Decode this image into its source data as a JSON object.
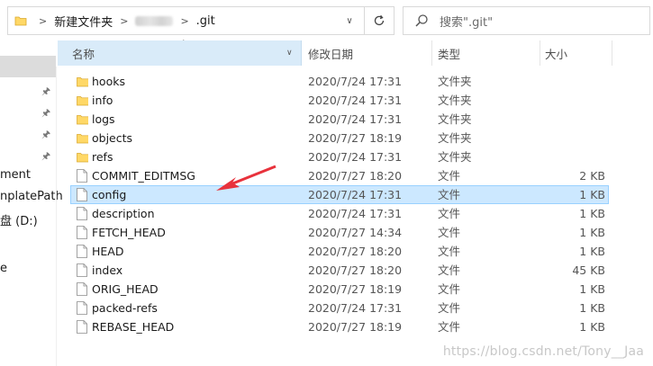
{
  "address": {
    "segment1": "新建文件夹",
    "segment3": ".git",
    "separator": ">"
  },
  "search": {
    "placeholder": "搜索\".git\""
  },
  "columns": {
    "name": "名称",
    "date": "修改日期",
    "type": "类型",
    "size": "大小"
  },
  "nav": {
    "items": [
      "ment",
      "nplatePath",
      "盘 (D:)",
      "e"
    ]
  },
  "files": [
    {
      "name": "hooks",
      "date": "2020/7/24 17:31",
      "type": "文件夹",
      "size": "",
      "kind": "folder"
    },
    {
      "name": "info",
      "date": "2020/7/24 17:31",
      "type": "文件夹",
      "size": "",
      "kind": "folder"
    },
    {
      "name": "logs",
      "date": "2020/7/24 17:31",
      "type": "文件夹",
      "size": "",
      "kind": "folder"
    },
    {
      "name": "objects",
      "date": "2020/7/27 18:19",
      "type": "文件夹",
      "size": "",
      "kind": "folder"
    },
    {
      "name": "refs",
      "date": "2020/7/24 17:31",
      "type": "文件夹",
      "size": "",
      "kind": "folder"
    },
    {
      "name": "COMMIT_EDITMSG",
      "date": "2020/7/27 18:20",
      "type": "文件",
      "size": "2 KB",
      "kind": "file"
    },
    {
      "name": "config",
      "date": "2020/7/24 17:31",
      "type": "文件",
      "size": "1 KB",
      "kind": "file",
      "selected": true
    },
    {
      "name": "description",
      "date": "2020/7/24 17:31",
      "type": "文件",
      "size": "1 KB",
      "kind": "file"
    },
    {
      "name": "FETCH_HEAD",
      "date": "2020/7/27 14:34",
      "type": "文件",
      "size": "1 KB",
      "kind": "file"
    },
    {
      "name": "HEAD",
      "date": "2020/7/27 18:20",
      "type": "文件",
      "size": "1 KB",
      "kind": "file"
    },
    {
      "name": "index",
      "date": "2020/7/27 18:20",
      "type": "文件",
      "size": "45 KB",
      "kind": "file"
    },
    {
      "name": "ORIG_HEAD",
      "date": "2020/7/27 18:19",
      "type": "文件",
      "size": "1 KB",
      "kind": "file"
    },
    {
      "name": "packed-refs",
      "date": "2020/7/24 17:31",
      "type": "文件",
      "size": "1 KB",
      "kind": "file"
    },
    {
      "name": "REBASE_HEAD",
      "date": "2020/7/27 18:19",
      "type": "文件",
      "size": "1 KB",
      "kind": "file"
    }
  ],
  "watermark": "https://blog.csdn.net/Tony__Jaa",
  "colors": {
    "folder": "#ffd867",
    "selection": "#cce8ff",
    "header_active": "#d9ebf9",
    "arrow": "#e8323c"
  }
}
